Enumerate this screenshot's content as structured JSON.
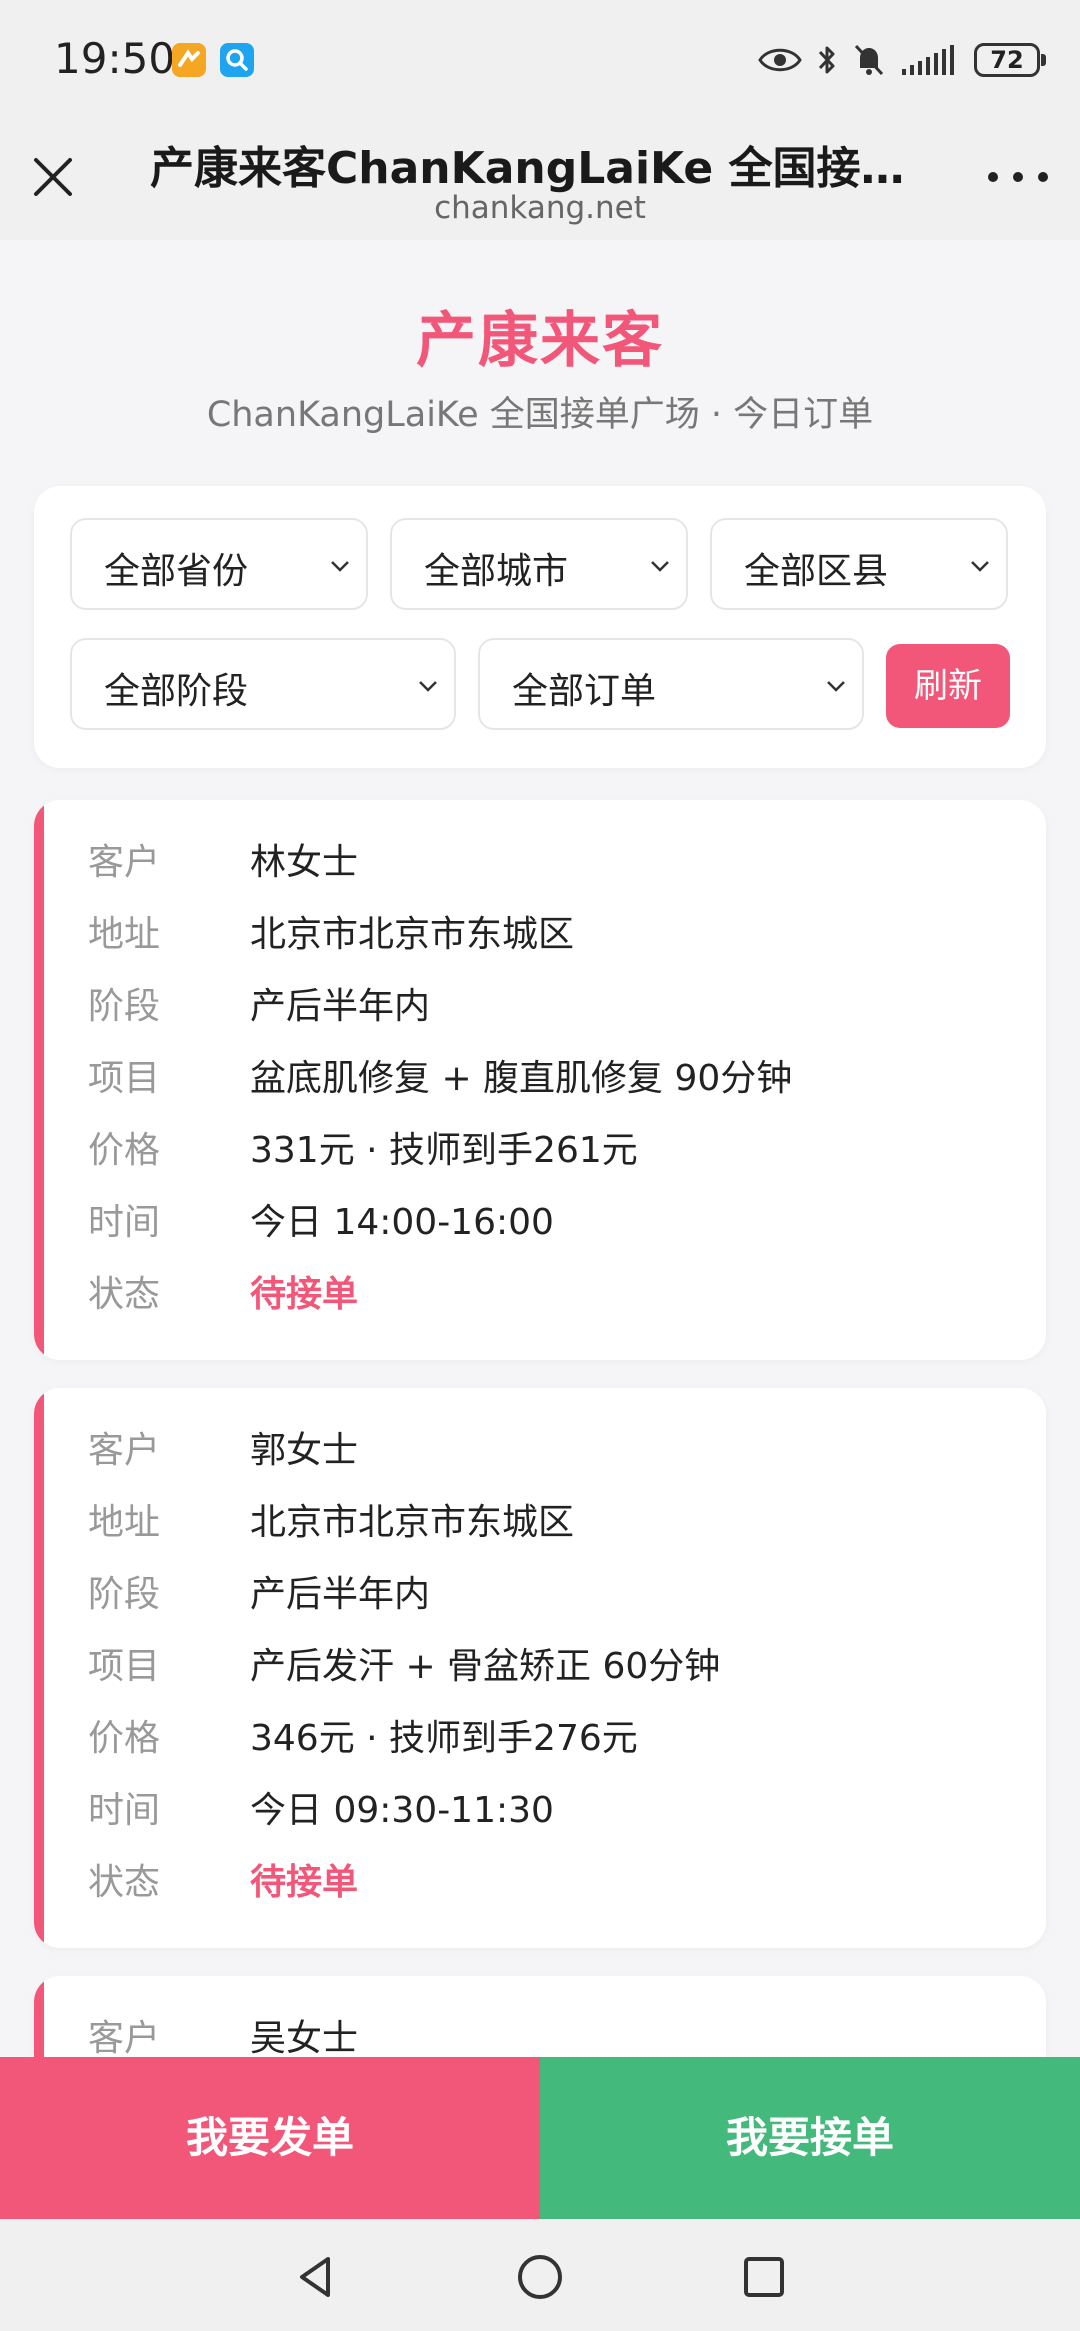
{
  "status_bar": {
    "time": "19:50",
    "battery": "72",
    "icons": [
      "app-notification-icon",
      "search-app-icon",
      "eye-icon",
      "bluetooth-icon",
      "bell-muted-icon",
      "signal-icon",
      "battery-icon"
    ]
  },
  "browser": {
    "title": "产康来客ChanKangLaiKe 全国接单…",
    "url": "chankang.net"
  },
  "hero": {
    "title": "产康来客",
    "subtitle": "ChanKangLaiKe 全国接单广场 · 今日订单"
  },
  "filters": {
    "province": "全部省份",
    "city": "全部城市",
    "district": "全部区县",
    "stage": "全部阶段",
    "order": "全部订单",
    "refresh": "刷新"
  },
  "labels": {
    "customer": "客户",
    "address": "地址",
    "stage": "阶段",
    "item": "项目",
    "price": "价格",
    "time": "时间",
    "status": "状态"
  },
  "orders": [
    {
      "customer": "林女士",
      "address": "北京市北京市东城区",
      "stage": "产后半年内",
      "item": "盆底肌修复 + 腹直肌修复 90分钟",
      "price": "331元 · 技师到手261元",
      "time": "今日 14:00-16:00",
      "status": "待接单"
    },
    {
      "customer": "郭女士",
      "address": "北京市北京市东城区",
      "stage": "产后半年内",
      "item": "产后发汗 + 骨盆矫正 60分钟",
      "price": "346元 · 技师到手276元",
      "time": "今日 09:30-11:30",
      "status": "待接单"
    },
    {
      "customer": "吴女士"
    }
  ],
  "actions": {
    "send": "我要发单",
    "take": "我要接单"
  },
  "colors": {
    "accent": "#f2577a",
    "green": "#44b97c"
  }
}
